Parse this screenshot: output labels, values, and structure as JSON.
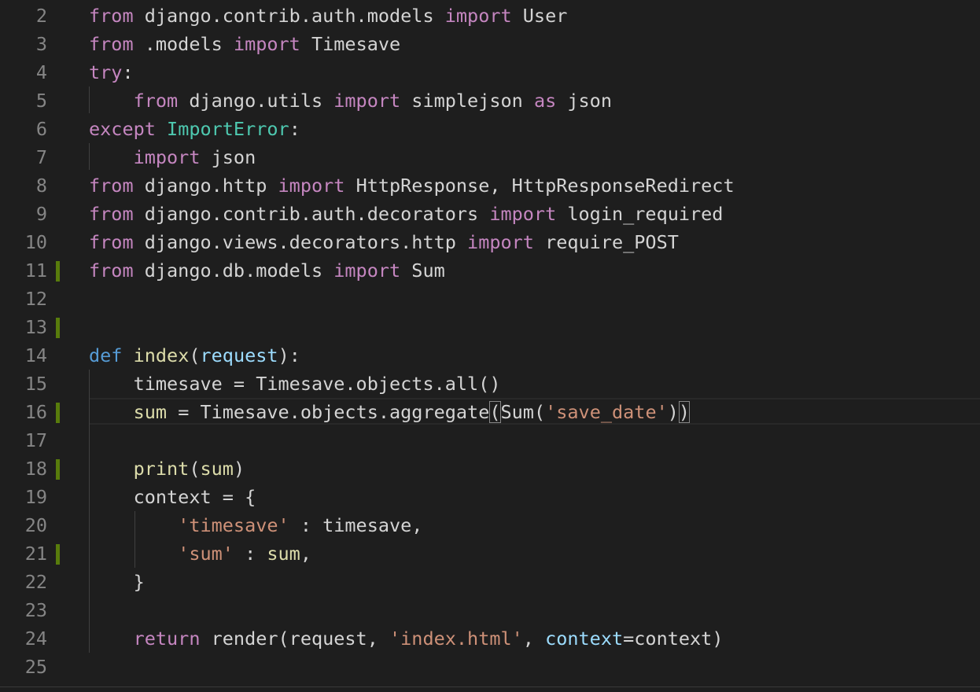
{
  "colors": {
    "background": "#1e1e1e",
    "line_number": "#858585",
    "keyword_control": "#c586c0",
    "keyword_def": "#569cd6",
    "function": "#dcdcaa",
    "class": "#4ec9b0",
    "variable_param": "#9cdcfe",
    "string": "#ce9178",
    "plain": "#d4d4d4",
    "modified_gutter": "#587c0c"
  },
  "editor": {
    "language": "python",
    "current_line": 16,
    "modified_lines": [
      11,
      13,
      16,
      18,
      21
    ],
    "lines": [
      {
        "n": "2",
        "tokens": [
          {
            "t": "from",
            "c": "#c586c0"
          },
          {
            "t": " django.contrib.auth.models ",
            "c": "#d4d4d4"
          },
          {
            "t": "import",
            "c": "#c586c0"
          },
          {
            "t": " User",
            "c": "#d4d4d4"
          }
        ]
      },
      {
        "n": "3",
        "tokens": [
          {
            "t": "from",
            "c": "#c586c0"
          },
          {
            "t": " .models ",
            "c": "#d4d4d4"
          },
          {
            "t": "import",
            "c": "#c586c0"
          },
          {
            "t": " Timesave",
            "c": "#d4d4d4"
          }
        ]
      },
      {
        "n": "4",
        "tokens": [
          {
            "t": "try",
            "c": "#c586c0"
          },
          {
            "t": ":",
            "c": "#d4d4d4"
          }
        ]
      },
      {
        "n": "5",
        "tokens": [
          {
            "t": "    ",
            "c": "#d4d4d4"
          },
          {
            "t": "from",
            "c": "#c586c0"
          },
          {
            "t": " django.utils ",
            "c": "#d4d4d4"
          },
          {
            "t": "import",
            "c": "#c586c0"
          },
          {
            "t": " simplejson ",
            "c": "#d4d4d4"
          },
          {
            "t": "as",
            "c": "#c586c0"
          },
          {
            "t": " json",
            "c": "#d4d4d4"
          }
        ]
      },
      {
        "n": "6",
        "tokens": [
          {
            "t": "except",
            "c": "#c586c0"
          },
          {
            "t": " ",
            "c": "#d4d4d4"
          },
          {
            "t": "ImportError",
            "c": "#4ec9b0"
          },
          {
            "t": ":",
            "c": "#d4d4d4"
          }
        ]
      },
      {
        "n": "7",
        "tokens": [
          {
            "t": "    ",
            "c": "#d4d4d4"
          },
          {
            "t": "import",
            "c": "#c586c0"
          },
          {
            "t": " json",
            "c": "#d4d4d4"
          }
        ]
      },
      {
        "n": "8",
        "tokens": [
          {
            "t": "from",
            "c": "#c586c0"
          },
          {
            "t": " django.http ",
            "c": "#d4d4d4"
          },
          {
            "t": "import",
            "c": "#c586c0"
          },
          {
            "t": " HttpResponse, HttpResponseRedirect",
            "c": "#d4d4d4"
          }
        ]
      },
      {
        "n": "9",
        "tokens": [
          {
            "t": "from",
            "c": "#c586c0"
          },
          {
            "t": " django.contrib.auth.decorators ",
            "c": "#d4d4d4"
          },
          {
            "t": "import",
            "c": "#c586c0"
          },
          {
            "t": " login_required",
            "c": "#d4d4d4"
          }
        ]
      },
      {
        "n": "10",
        "tokens": [
          {
            "t": "from",
            "c": "#c586c0"
          },
          {
            "t": " django.views.decorators.http ",
            "c": "#d4d4d4"
          },
          {
            "t": "import",
            "c": "#c586c0"
          },
          {
            "t": " require_POST",
            "c": "#d4d4d4"
          }
        ]
      },
      {
        "n": "11",
        "tokens": [
          {
            "t": "from",
            "c": "#c586c0"
          },
          {
            "t": " django.db.models ",
            "c": "#d4d4d4"
          },
          {
            "t": "import",
            "c": "#c586c0"
          },
          {
            "t": " Sum",
            "c": "#d4d4d4"
          }
        ]
      },
      {
        "n": "12",
        "tokens": []
      },
      {
        "n": "13",
        "tokens": []
      },
      {
        "n": "14",
        "tokens": [
          {
            "t": "def",
            "c": "#569cd6"
          },
          {
            "t": " ",
            "c": "#d4d4d4"
          },
          {
            "t": "index",
            "c": "#dcdcaa"
          },
          {
            "t": "(",
            "c": "#d4d4d4"
          },
          {
            "t": "request",
            "c": "#9cdcfe"
          },
          {
            "t": "):",
            "c": "#d4d4d4"
          }
        ]
      },
      {
        "n": "15",
        "tokens": [
          {
            "t": "    timesave = Timesave.objects.all()",
            "c": "#d4d4d4"
          }
        ]
      },
      {
        "n": "16",
        "tokens": [
          {
            "t": "    ",
            "c": "#d4d4d4"
          },
          {
            "t": "sum",
            "c": "#dcdcaa"
          },
          {
            "t": " = Timesave.objects.aggregate",
            "c": "#d4d4d4"
          },
          {
            "t": "(",
            "c": "#d4d4d4",
            "b": true
          },
          {
            "t": "Sum(",
            "c": "#d4d4d4"
          },
          {
            "t": "'save_date'",
            "c": "#ce9178"
          },
          {
            "t": ")",
            "c": "#d4d4d4"
          },
          {
            "t": ")",
            "c": "#d4d4d4",
            "b": true
          }
        ]
      },
      {
        "n": "17",
        "tokens": []
      },
      {
        "n": "18",
        "tokens": [
          {
            "t": "    ",
            "c": "#d4d4d4"
          },
          {
            "t": "print",
            "c": "#dcdcaa"
          },
          {
            "t": "(",
            "c": "#d4d4d4"
          },
          {
            "t": "sum",
            "c": "#dcdcaa"
          },
          {
            "t": ")",
            "c": "#d4d4d4"
          }
        ]
      },
      {
        "n": "19",
        "tokens": [
          {
            "t": "    context = {",
            "c": "#d4d4d4"
          }
        ]
      },
      {
        "n": "20",
        "tokens": [
          {
            "t": "        ",
            "c": "#d4d4d4"
          },
          {
            "t": "'timesave'",
            "c": "#ce9178"
          },
          {
            "t": " : timesave,",
            "c": "#d4d4d4"
          }
        ]
      },
      {
        "n": "21",
        "tokens": [
          {
            "t": "        ",
            "c": "#d4d4d4"
          },
          {
            "t": "'sum'",
            "c": "#ce9178"
          },
          {
            "t": " : ",
            "c": "#d4d4d4"
          },
          {
            "t": "sum",
            "c": "#dcdcaa"
          },
          {
            "t": ",",
            "c": "#d4d4d4"
          }
        ]
      },
      {
        "n": "22",
        "tokens": [
          {
            "t": "    }",
            "c": "#d4d4d4"
          }
        ]
      },
      {
        "n": "23",
        "tokens": []
      },
      {
        "n": "24",
        "tokens": [
          {
            "t": "    ",
            "c": "#d4d4d4"
          },
          {
            "t": "return",
            "c": "#c586c0"
          },
          {
            "t": " render(request, ",
            "c": "#d4d4d4"
          },
          {
            "t": "'index.html'",
            "c": "#ce9178"
          },
          {
            "t": ", ",
            "c": "#d4d4d4"
          },
          {
            "t": "context",
            "c": "#9cdcfe"
          },
          {
            "t": "=context)",
            "c": "#d4d4d4"
          }
        ]
      },
      {
        "n": "25",
        "tokens": []
      }
    ]
  }
}
